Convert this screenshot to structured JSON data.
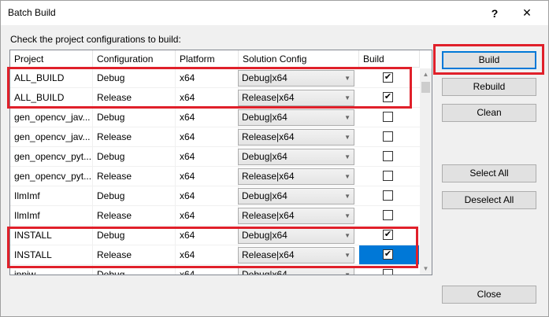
{
  "window": {
    "title": "Batch Build",
    "help_glyph": "?",
    "close_glyph": "✕"
  },
  "instructions": "Check the project configurations to build:",
  "columns": [
    "Project",
    "Configuration",
    "Platform",
    "Solution Config",
    "Build"
  ],
  "rows": [
    {
      "project": "ALL_BUILD",
      "config": "Debug",
      "platform": "x64",
      "solution": "Debug|x64",
      "build": true
    },
    {
      "project": "ALL_BUILD",
      "config": "Release",
      "platform": "x64",
      "solution": "Release|x64",
      "build": true
    },
    {
      "project": "gen_opencv_jav...",
      "config": "Debug",
      "platform": "x64",
      "solution": "Debug|x64",
      "build": false
    },
    {
      "project": "gen_opencv_jav...",
      "config": "Release",
      "platform": "x64",
      "solution": "Release|x64",
      "build": false
    },
    {
      "project": "gen_opencv_pyt...",
      "config": "Debug",
      "platform": "x64",
      "solution": "Debug|x64",
      "build": false
    },
    {
      "project": "gen_opencv_pyt...",
      "config": "Release",
      "platform": "x64",
      "solution": "Release|x64",
      "build": false
    },
    {
      "project": "IlmImf",
      "config": "Debug",
      "platform": "x64",
      "solution": "Debug|x64",
      "build": false
    },
    {
      "project": "IlmImf",
      "config": "Release",
      "platform": "x64",
      "solution": "Release|x64",
      "build": false
    },
    {
      "project": "INSTALL",
      "config": "Debug",
      "platform": "x64",
      "solution": "Debug|x64",
      "build": true
    },
    {
      "project": "INSTALL",
      "config": "Release",
      "platform": "x64",
      "solution": "Release|x64",
      "build": true,
      "selected": true
    },
    {
      "project": "ippiw",
      "config": "Debug",
      "platform": "x64",
      "solution": "Debug|x64",
      "build": false
    }
  ],
  "buttons": {
    "build": "Build",
    "rebuild": "Rebuild",
    "clean": "Clean",
    "select_all": "Select All",
    "deselect_all": "Deselect All",
    "close": "Close"
  },
  "colors": {
    "annotation": "#e0202a",
    "selection": "#0078d7"
  },
  "icons": {
    "combo_arrow": "chevron-down-icon",
    "check": "checkmark-icon"
  }
}
